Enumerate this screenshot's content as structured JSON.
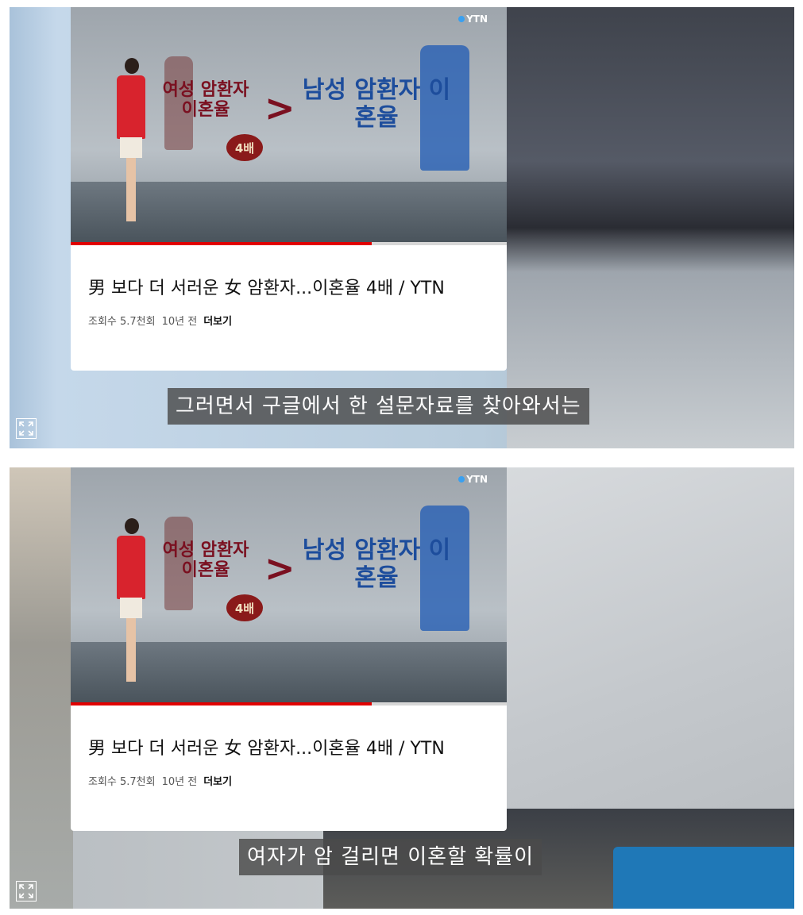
{
  "frames": [
    {
      "thumbnail": {
        "channel_logo": "YTN",
        "graphic_left": "여성 암환자 이혼율",
        "graphic_right": "남성 암환자 이혼율",
        "graphic_badge": "4배"
      },
      "progress": 0.69,
      "card": {
        "title": "男 보다 더 서러운 女 암환자...이혼율 4배 / YTN",
        "views": "조회수 5.7천회",
        "age": "10년 전",
        "more": "더보기"
      },
      "subtitle": "그러면서 구글에서 한 설문자료를 찾아와서는",
      "icons": {
        "expand": "expand-icon"
      }
    },
    {
      "thumbnail": {
        "channel_logo": "YTN",
        "graphic_left": "여성 암환자 이혼율",
        "graphic_right": "남성 암환자 이혼율",
        "graphic_badge": "4배"
      },
      "progress": 0.69,
      "card": {
        "title": "男 보다 더 서러운 女 암환자...이혼율 4배 / YTN",
        "views": "조회수 5.7천회",
        "age": "10년 전",
        "more": "더보기"
      },
      "subtitle": "여자가 암 걸리면 이혼할 확률이",
      "icons": {
        "expand": "expand-icon"
      }
    }
  ]
}
